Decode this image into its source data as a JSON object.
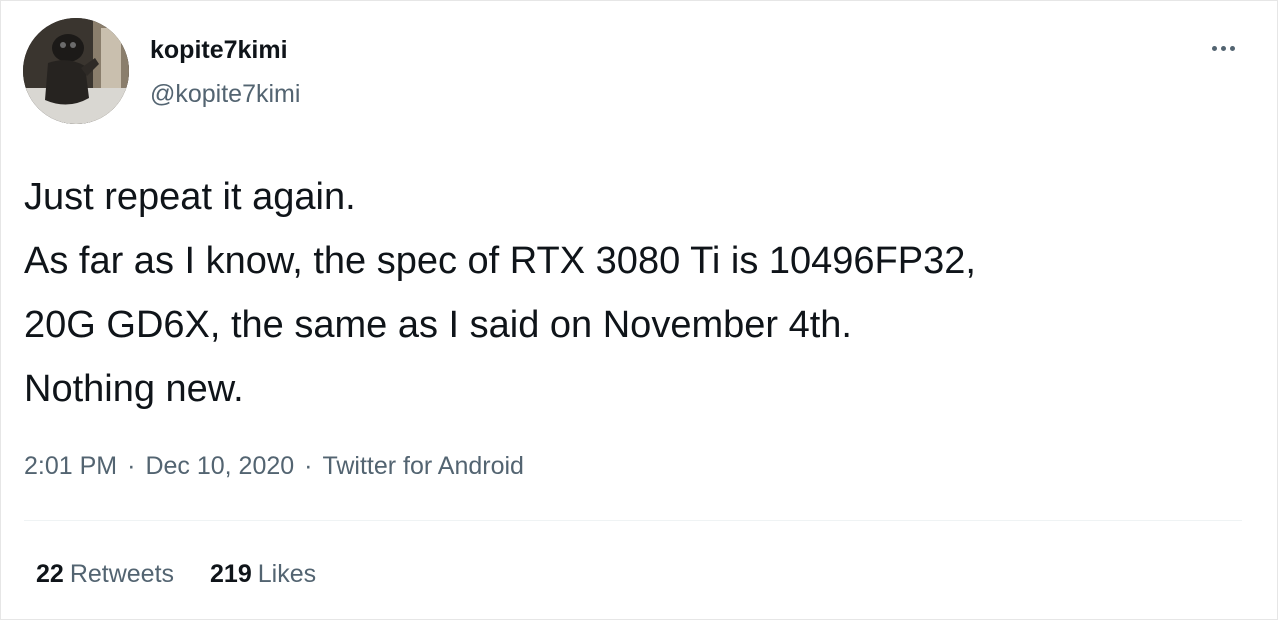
{
  "user": {
    "display_name": "kopite7kimi",
    "handle": "@kopite7kimi",
    "avatar_icon": "user-avatar"
  },
  "more_menu": {
    "icon": "more-options-icon"
  },
  "tweet": {
    "lines": [
      "Just repeat it again.",
      "As far as I know, the spec of RTX 3080 Ti is 10496FP32,",
      "20G GD6X, the same as I said on November 4th.",
      "Nothing new."
    ]
  },
  "meta": {
    "time": "2:01 PM",
    "separator": "·",
    "date": "Dec 10, 2020",
    "source": "Twitter for Android"
  },
  "stats": {
    "retweets_count": "22",
    "retweets_label": "Retweets",
    "likes_count": "219",
    "likes_label": "Likes"
  },
  "colors": {
    "primary_text": "#0f1419",
    "secondary_text": "#536471",
    "divider": "#eff3f4"
  }
}
